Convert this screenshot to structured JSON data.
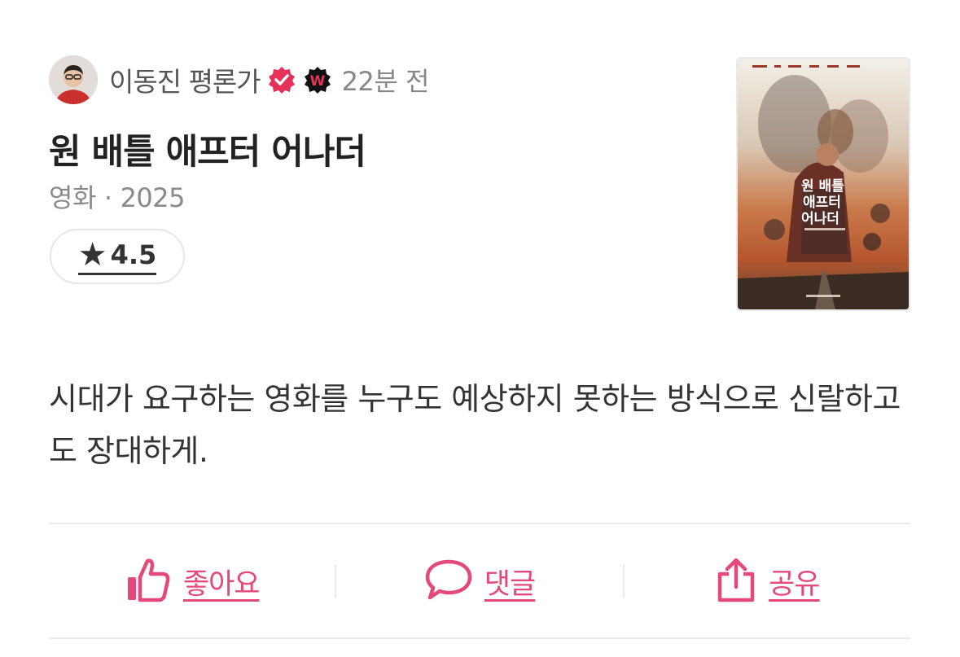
{
  "author": {
    "name": "이동진 평론가",
    "time": "22분 전",
    "badge_letter": "W"
  },
  "title": "원 배틀 애프터 어나더",
  "meta": {
    "category": "영화",
    "separator": "·",
    "year": "2025"
  },
  "rating": {
    "value": "4.5",
    "icon": "star-icon"
  },
  "poster": {
    "title_line1": "원 배틀",
    "title_line2": "애프터",
    "title_line3": "어나더"
  },
  "review": {
    "text": "시대가 요구하는 영화를 누구도 예상하지 못하는 방식으로 신랄하고도 장대하게."
  },
  "actions": {
    "like_label": "좋아요",
    "comment_label": "댓글",
    "share_label": "공유"
  },
  "colors": {
    "accent": "#e5487a",
    "badge_black": "#111111",
    "badge_red": "#e6315b"
  }
}
